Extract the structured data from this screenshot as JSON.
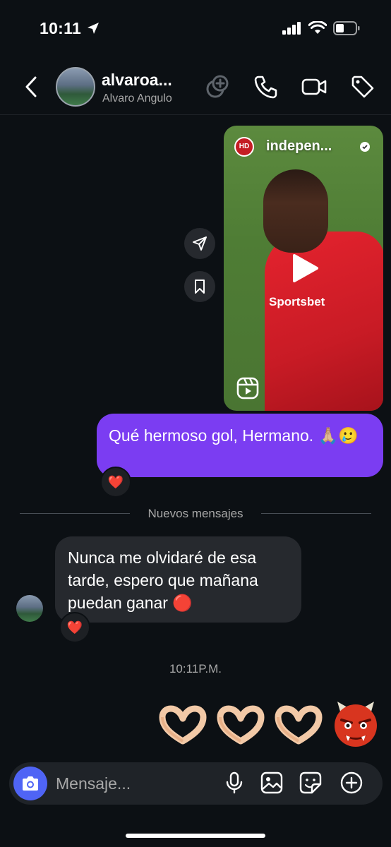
{
  "status_bar": {
    "time": "10:11"
  },
  "header": {
    "username": "alvaroa...",
    "display_name": "Alvaro Angulo",
    "icons": [
      "back-icon",
      "avatar",
      "effects-icon",
      "phone-icon",
      "video-icon",
      "tag-icon"
    ]
  },
  "reel": {
    "channel_name": "indepen...",
    "channel_logo_text": "HD",
    "sponsor_text": "Sportsbet",
    "play_icon": "play-icon",
    "reel_icon": "reels-icon"
  },
  "sent_message": {
    "text": "Qué hermoso gol, Hermano. 🙏🏼🥲",
    "reaction": "❤️"
  },
  "divider": {
    "label": "Nuevos mensajes"
  },
  "received_message": {
    "text": "Nunca me olvidaré de esa tarde, espero que mañana puedan ganar 🔴",
    "reaction": "❤️"
  },
  "timestamp": "10:11P.M.",
  "emoji_message": [
    "🫶🏻",
    "🫶🏻",
    "🫶🏻",
    "👹"
  ],
  "composer": {
    "placeholder": "Mensaje...",
    "icons": [
      "camera-icon",
      "microphone-icon",
      "gallery-icon",
      "sticker-icon",
      "add-icon"
    ]
  },
  "colors": {
    "background": "#0c1014",
    "sent_bubble": "#7b3df2",
    "received_bubble": "#26292e",
    "camera_button": "#4f64f5"
  }
}
